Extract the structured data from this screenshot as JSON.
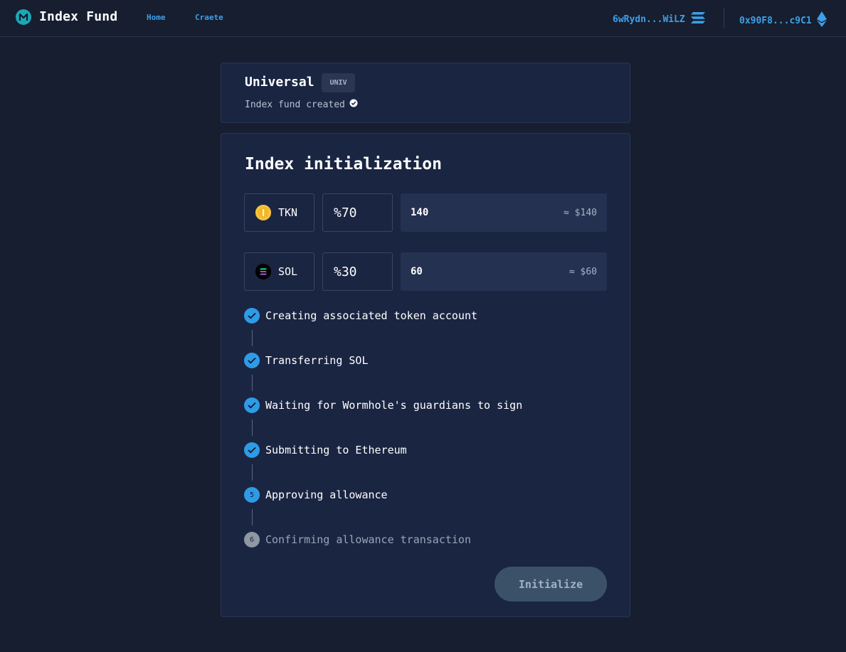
{
  "header": {
    "brand": "Index Fund",
    "nav": [
      {
        "label": "Home"
      },
      {
        "label": "Craete"
      }
    ],
    "wallets": [
      {
        "address": "6wRydn...WiLZ",
        "chain_icon": "solana-icon"
      },
      {
        "address": "0x90F8...c9C1",
        "chain_icon": "ethereum-icon"
      }
    ]
  },
  "fund": {
    "name": "Universal",
    "ticker": "UNIV",
    "status": "Index fund created"
  },
  "init": {
    "title": "Index initialization",
    "tokens": [
      {
        "symbol": "TKN",
        "percent": "%70",
        "amount": "140",
        "usd": "≈ $140",
        "icon": "tkn-coin-icon",
        "color": "#f5c23d"
      },
      {
        "symbol": "SOL",
        "percent": "%30",
        "amount": "60",
        "usd": "≈ $60",
        "icon": "solana-coin-icon",
        "color": "#000000"
      }
    ],
    "steps": [
      {
        "label": "Creating associated token account",
        "state": "done",
        "number": "1"
      },
      {
        "label": "Transferring SOL",
        "state": "done",
        "number": "2"
      },
      {
        "label": "Waiting for Wormhole's guardians to sign",
        "state": "done",
        "number": "3"
      },
      {
        "label": "Submitting to Ethereum",
        "state": "done",
        "number": "4"
      },
      {
        "label": "Approving allowance",
        "state": "active",
        "number": "5"
      },
      {
        "label": "Confirming allowance transaction",
        "state": "pending",
        "number": "6"
      }
    ],
    "button_label": "Initialize"
  },
  "colors": {
    "background": "#161e30",
    "card": "#1a2542",
    "accent": "#3ea0e8",
    "step_done": "#2f9be6",
    "step_pending": "#8f96a4",
    "button_disabled": "#3b5168"
  }
}
